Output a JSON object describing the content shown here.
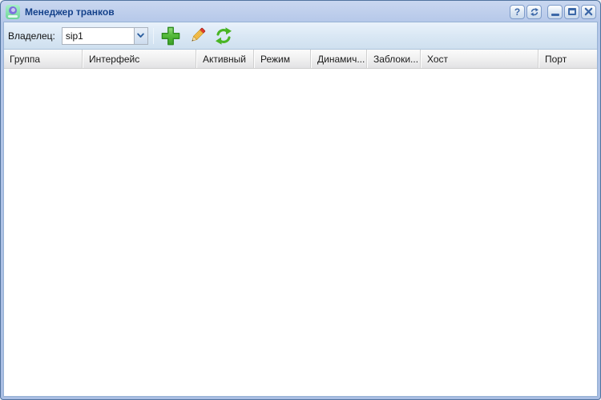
{
  "window": {
    "title": "Менеджер транков",
    "help_glyph": "?"
  },
  "toolbar": {
    "owner_label": "Владелец:",
    "owner_value": "sip1",
    "buttons": [
      {
        "name": "add"
      },
      {
        "name": "edit"
      },
      {
        "name": "refresh"
      }
    ]
  },
  "grid": {
    "columns": [
      "Группа",
      "Интерфейс",
      "Активный",
      "Режим",
      "Динамич...",
      "Заблоки...",
      "Хост",
      "Порт"
    ],
    "rows": []
  },
  "colors": {
    "title_text": "#15428b",
    "frame_blue": "#b1c5e7",
    "toolbar_bg": "#d9e7f4",
    "icon_green": "#49b524",
    "pencil_yellow": "#f7c64f",
    "control_blue": "#3c68a8"
  }
}
